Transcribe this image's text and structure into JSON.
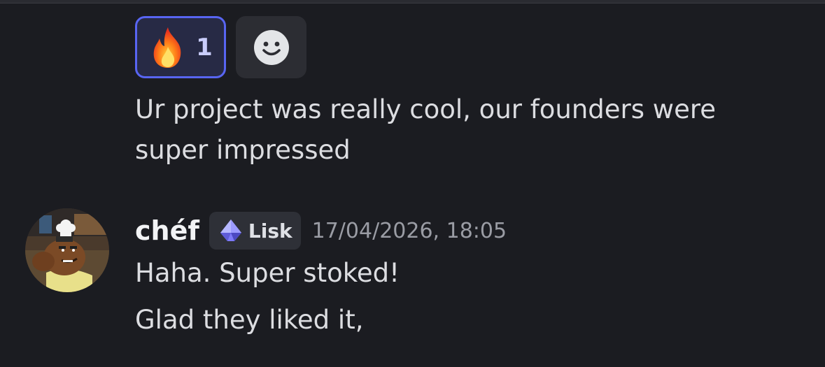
{
  "reactions": [
    {
      "emoji": "🔥",
      "icon": "fire-icon",
      "count": "1",
      "selected": true
    }
  ],
  "add_reaction": {
    "icon": "smiley-add-reaction-icon"
  },
  "previous_message": {
    "lines": [
      "Ur project was really cool, our founders were",
      "super impressed"
    ]
  },
  "message": {
    "author": "chéf",
    "tag": {
      "label": "Lisk",
      "icon": "lisk-gem-icon"
    },
    "timestamp": "17/04/2026, 18:05",
    "lines": [
      "Haha. Super stoked!",
      "Glad they liked it,"
    ]
  },
  "colors": {
    "background": "#1b1c21",
    "reaction_selected_border": "#5865f2",
    "reaction_selected_bg": "#272a45",
    "text": "#dcdde1",
    "timestamp": "#9a9ca4"
  }
}
